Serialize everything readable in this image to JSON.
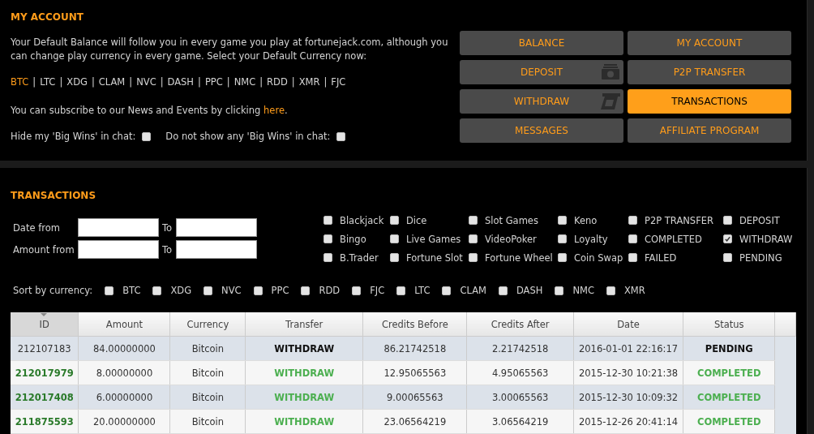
{
  "account": {
    "title": "MY ACCOUNT",
    "intro": "Your Default Balance will follow you in every game you play at fortunejack.com, although you can change play currency in every game. Select your Default Currency now:",
    "currencies": [
      {
        "label": "BTC",
        "selected": true
      },
      {
        "label": "LTC",
        "selected": false
      },
      {
        "label": "XDG",
        "selected": false
      },
      {
        "label": "CLAM",
        "selected": false
      },
      {
        "label": "NVC",
        "selected": false
      },
      {
        "label": "DASH",
        "selected": false
      },
      {
        "label": "PPC",
        "selected": false
      },
      {
        "label": "NMC",
        "selected": false
      },
      {
        "label": "RDD",
        "selected": false
      },
      {
        "label": "XMR",
        "selected": false
      },
      {
        "label": "FJC",
        "selected": false
      }
    ],
    "separator": "|",
    "subscribe_text": "You can subscribe to our News and Events by clicking ",
    "subscribe_link": "here",
    "subscribe_end": ".",
    "options": [
      {
        "label": "Hide my 'Big Wins' in chat:",
        "checked": false
      },
      {
        "label": "Do not show any 'Big Wins' in chat:",
        "checked": false
      }
    ]
  },
  "nav": [
    {
      "label": "BALANCE",
      "selected": false,
      "kind": "plain"
    },
    {
      "label": "MY ACCOUNT",
      "selected": false,
      "kind": "plain"
    },
    {
      "label": "DEPOSIT",
      "selected": false,
      "kind": "cash"
    },
    {
      "label": "P2P TRANSFER",
      "selected": false,
      "kind": "plain"
    },
    {
      "label": "WITHDRAW",
      "selected": false,
      "kind": "slip"
    },
    {
      "label": "TRANSACTIONS",
      "selected": true,
      "kind": "plain"
    },
    {
      "label": "MESSAGES",
      "selected": false,
      "kind": "plain"
    },
    {
      "label": "AFFILIATE PROGRAM",
      "selected": false,
      "kind": "plain"
    }
  ],
  "transactions": {
    "title": "TRANSACTIONS",
    "date_from": "Date from",
    "amount_from": "Amount from",
    "to_1": "To",
    "to_2": "To",
    "filters": [
      {
        "label": "Blackjack",
        "checked": false
      },
      {
        "label": "Dice",
        "checked": false
      },
      {
        "label": "Slot Games",
        "checked": false
      },
      {
        "label": "Keno",
        "checked": false
      },
      {
        "label": "P2P TRANSFER",
        "checked": false
      },
      {
        "label": "DEPOSIT",
        "checked": false
      },
      {
        "label": "Bingo",
        "checked": false
      },
      {
        "label": "Live Games",
        "checked": false
      },
      {
        "label": "VideoPoker",
        "checked": false
      },
      {
        "label": "Loyalty",
        "checked": false
      },
      {
        "label": "COMPLETED",
        "checked": false
      },
      {
        "label": "WITHDRAW",
        "checked": true
      },
      {
        "label": "B.Trader",
        "checked": false
      },
      {
        "label": "Fortune Slot",
        "checked": false
      },
      {
        "label": "Fortune Wheel",
        "checked": false
      },
      {
        "label": "Coin Swap",
        "checked": false
      },
      {
        "label": "FAILED",
        "checked": false
      },
      {
        "label": "PENDING",
        "checked": false
      }
    ],
    "sort_label": "Sort by currency:",
    "sort_currencies": [
      {
        "label": "BTC",
        "checked": false
      },
      {
        "label": "XDG",
        "checked": false
      },
      {
        "label": "NVC",
        "checked": false
      },
      {
        "label": "PPC",
        "checked": false
      },
      {
        "label": "RDD",
        "checked": false
      },
      {
        "label": "FJC",
        "checked": false
      },
      {
        "label": "LTC",
        "checked": false
      },
      {
        "label": "CLAM",
        "checked": false
      },
      {
        "label": "DASH",
        "checked": false
      },
      {
        "label": "NMC",
        "checked": false
      },
      {
        "label": "XMR",
        "checked": false
      }
    ]
  },
  "table": {
    "columns": [
      "ID",
      "Amount",
      "Currency",
      "Transfer",
      "Credits Before",
      "Credits After",
      "Date",
      "Status"
    ],
    "rows": [
      {
        "kind": "pending",
        "cells": [
          "212107183",
          "84.00000000",
          "Bitcoin",
          "WITHDRAW",
          "86.21742518",
          "2.21742518",
          "2016-01-01 22:16:17",
          "PENDING"
        ]
      },
      {
        "kind": "completed",
        "cells": [
          "212017979",
          "8.00000000",
          "Bitcoin",
          "WITHDRAW",
          "12.95065563",
          "4.95065563",
          "2015-12-30 10:21:38",
          "COMPLETED"
        ]
      },
      {
        "kind": "completed",
        "cells": [
          "212017408",
          "6.00000000",
          "Bitcoin",
          "WITHDRAW",
          "9.00065563",
          "3.00065563",
          "2015-12-30 10:09:32",
          "COMPLETED"
        ]
      },
      {
        "kind": "completed",
        "cells": [
          "211875593",
          "20.00000000",
          "Bitcoin",
          "WITHDRAW",
          "23.06564219",
          "3.06564219",
          "2015-12-26 20:41:14",
          "COMPLETED"
        ]
      }
    ]
  }
}
